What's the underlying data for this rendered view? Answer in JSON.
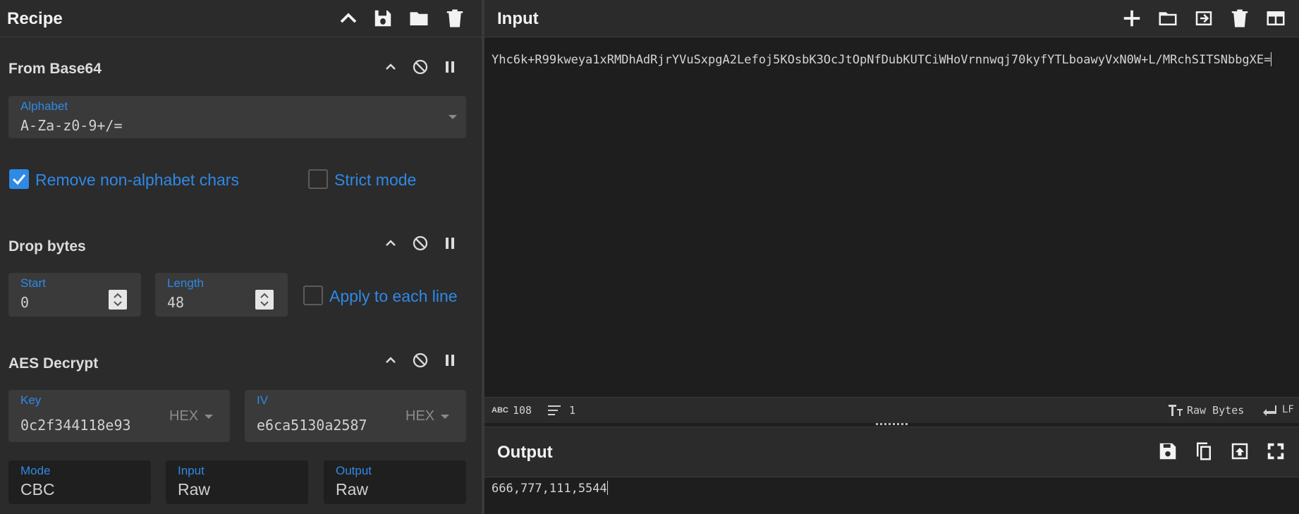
{
  "recipe": {
    "title": "Recipe",
    "operations": [
      {
        "name": "From Base64",
        "alphabet_label": "Alphabet",
        "alphabet_value": "A-Za-z0-9+/=",
        "remove_non_alphabet_label": "Remove non-alphabet chars",
        "remove_non_alphabet_checked": true,
        "strict_mode_label": "Strict mode",
        "strict_mode_checked": false
      },
      {
        "name": "Drop bytes",
        "start_label": "Start",
        "start_value": "0",
        "length_label": "Length",
        "length_value": "48",
        "apply_each_line_label": "Apply to each line",
        "apply_each_line_checked": false
      },
      {
        "name": "AES Decrypt",
        "key_label": "Key",
        "key_value": "0c2f344118e93",
        "key_format": "HEX",
        "iv_label": "IV",
        "iv_value": "e6ca5130a2587",
        "iv_format": "HEX",
        "mode_label": "Mode",
        "mode_value": "CBC",
        "input_label": "Input",
        "input_value": "Raw",
        "output_label": "Output",
        "output_value": "Raw"
      }
    ]
  },
  "input": {
    "title": "Input",
    "text": "Yhc6k+R99kweya1xRMDhAdRjrYVuSxpgA2Lefoj5KOsbK3OcJtOpNfDubKUTCiWHoVrnnwqj70kyfYTLboawyVxN0W+L/MRchSITSNbbgXE=",
    "length": "108",
    "lines": "1",
    "encoding": "Raw Bytes",
    "eol": "LF"
  },
  "output": {
    "title": "Output",
    "text": "666,777,111,5544"
  },
  "colors": {
    "accent": "#2f89e6",
    "panel": "#2b2b2b",
    "background": "#1e1e1e"
  },
  "icons": [
    "chevron-up-icon",
    "save-icon",
    "folder-icon",
    "trash-icon",
    "disable-icon",
    "pause-icon",
    "plus-icon",
    "import-icon",
    "layout-icon",
    "copy-icon",
    "replace-input-icon",
    "maximize-icon",
    "text-format-icon",
    "eol-icon"
  ]
}
